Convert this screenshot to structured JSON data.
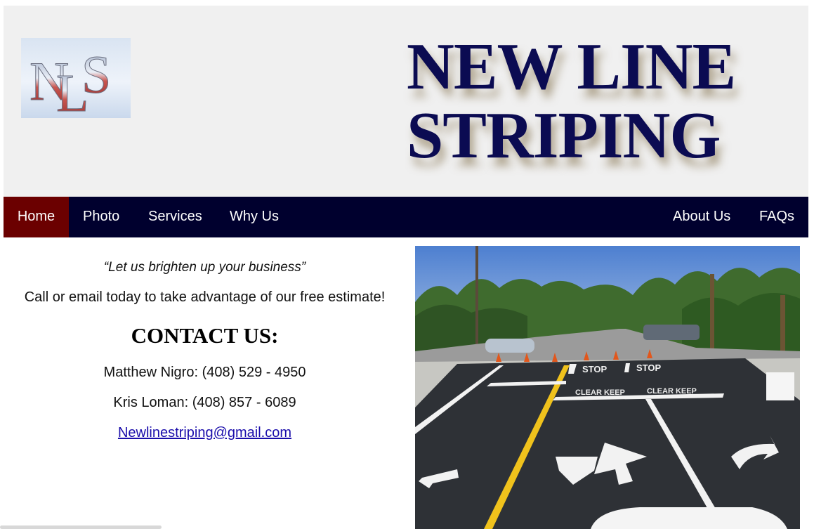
{
  "header": {
    "logo_letters": "NLS",
    "brand_line_1": "NEW LINE",
    "brand_line_2": "STRIPING"
  },
  "nav": {
    "items": [
      {
        "label": "Home",
        "active": true
      },
      {
        "label": "Photo",
        "active": false
      },
      {
        "label": "Services",
        "active": false
      },
      {
        "label": "Why Us",
        "active": false
      },
      {
        "label": "About Us",
        "active": false
      },
      {
        "label": "FAQs",
        "active": false
      }
    ]
  },
  "main": {
    "tagline": "“Let us brighten up your business”",
    "call_text": "Call or email today to take advantage of our free estimate!",
    "contact_heading": "CONTACT US:",
    "contacts": [
      {
        "text": "Matthew Nigro: (408) 529 - 4950"
      },
      {
        "text": "Kris Loman: (408) 857 - 6089"
      }
    ],
    "email": "Newlinestriping@gmail.com"
  },
  "photo": {
    "road_markings": {
      "stop_1": "STOP",
      "stop_2": "STOP",
      "keep_clear_1": "CLEAR KEEP",
      "keep_clear_2": "CLEAR KEEP"
    }
  },
  "colors": {
    "header_bg": "#f0f0f0",
    "brand_text": "#0b0b52",
    "nav_bg": "#00002e",
    "nav_active": "#6b0000",
    "link": "#1a0dab"
  }
}
